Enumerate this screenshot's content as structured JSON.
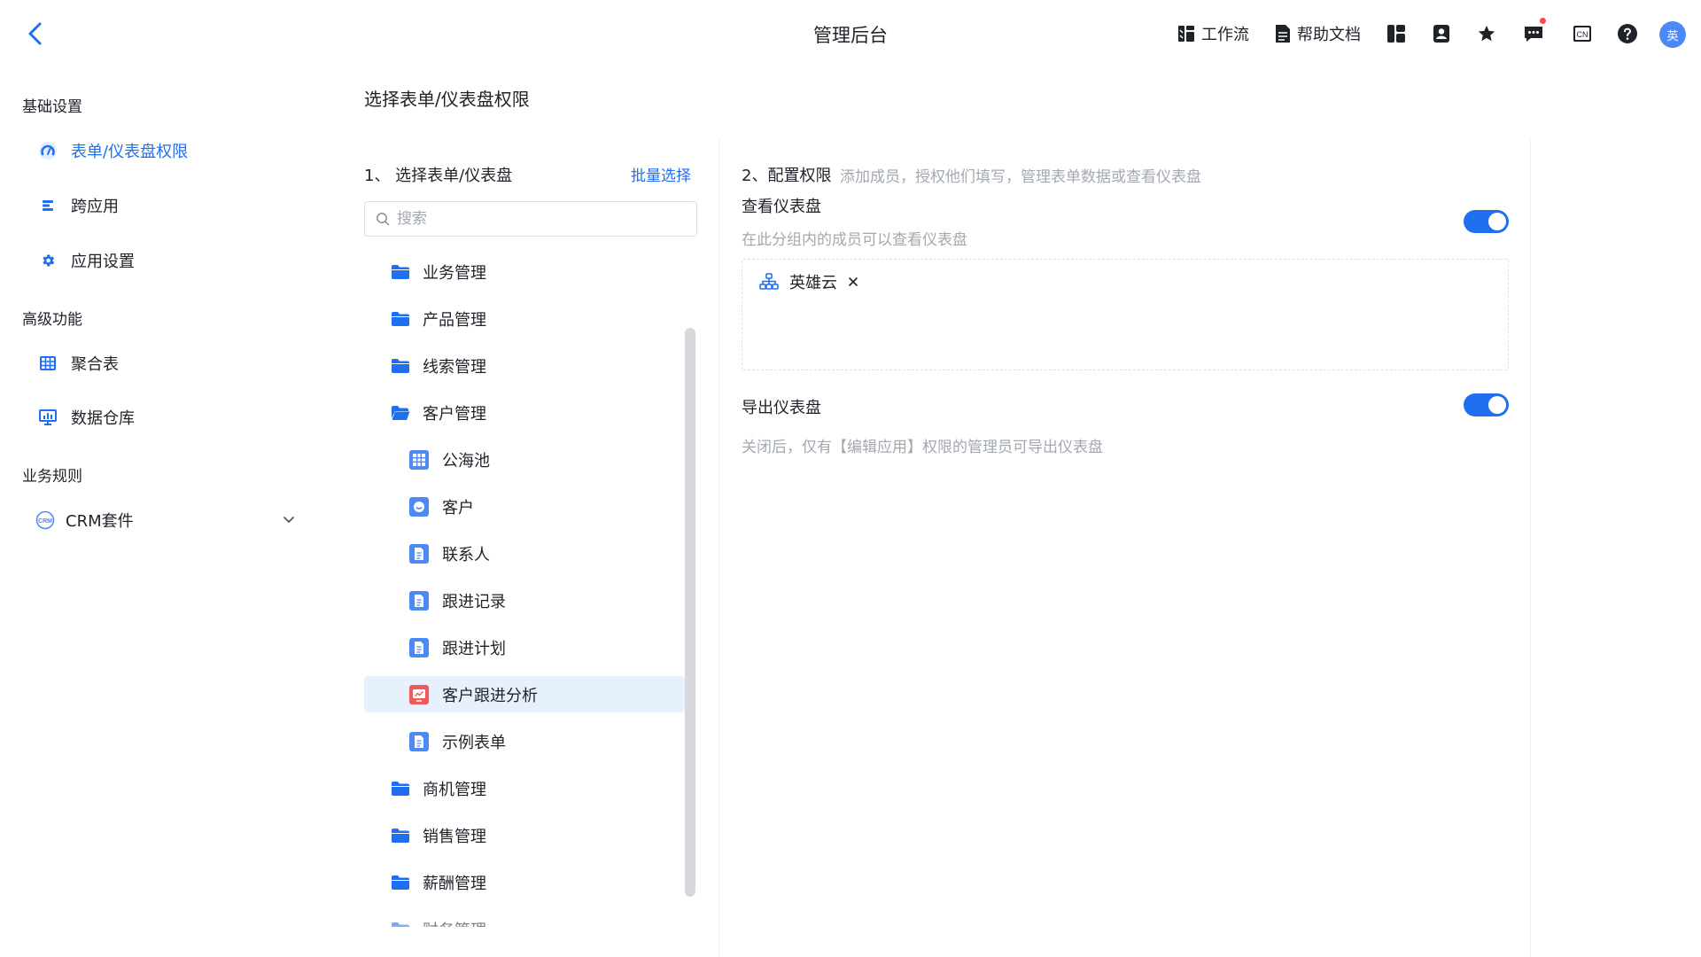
{
  "header": {
    "title": "管理后台",
    "workflow_label": "工作流",
    "help_label": "帮助文档",
    "avatar_text": "英",
    "lang_label": "CN"
  },
  "sidebar": {
    "sections": [
      {
        "title": "基础设置",
        "items": [
          {
            "label": "表单/仪表盘权限",
            "icon": "dashboard-gauge-icon",
            "active": true
          },
          {
            "label": "跨应用",
            "icon": "cross-app-icon"
          },
          {
            "label": "应用设置",
            "icon": "gear-icon"
          }
        ]
      },
      {
        "title": "高级功能",
        "items": [
          {
            "label": "聚合表",
            "icon": "table-grid-icon"
          },
          {
            "label": "数据仓库",
            "icon": "data-warehouse-icon"
          }
        ]
      },
      {
        "title": "业务规则",
        "items": [
          {
            "label": "CRM套件",
            "icon": "crm-icon",
            "expandable": true
          }
        ]
      }
    ]
  },
  "main": {
    "title": "选择表单/仪表盘权限",
    "step1_label": "1、 选择表单/仪表盘",
    "batch_select_label": "批量选择",
    "search_placeholder": "搜索",
    "tree": [
      {
        "label": "业务管理",
        "type": "folder"
      },
      {
        "label": "产品管理",
        "type": "folder"
      },
      {
        "label": "线索管理",
        "type": "folder"
      },
      {
        "label": "客户管理",
        "type": "folder-open"
      },
      {
        "label": "公海池",
        "type": "table"
      },
      {
        "label": "客户",
        "type": "customer"
      },
      {
        "label": "联系人",
        "type": "form"
      },
      {
        "label": "跟进记录",
        "type": "form"
      },
      {
        "label": "跟进计划",
        "type": "form"
      },
      {
        "label": "客户跟进分析",
        "type": "dashboard",
        "selected": true
      },
      {
        "label": "示例表单",
        "type": "form"
      },
      {
        "label": "商机管理",
        "type": "folder"
      },
      {
        "label": "销售管理",
        "type": "folder"
      },
      {
        "label": "薪酬管理",
        "type": "folder"
      },
      {
        "label": "财务管理",
        "type": "folder"
      }
    ]
  },
  "permissions": {
    "step2_label": "2、配置权限",
    "step2_desc": "添加成员，授权他们填写，管理表单数据或查看仪表盘",
    "view": {
      "title": "查看仪表盘",
      "desc": "在此分组内的成员可以查看仪表盘",
      "enabled": true,
      "members": [
        {
          "name": "英雄云",
          "icon": "org-structure-icon"
        }
      ]
    },
    "export": {
      "title": "导出仪表盘",
      "desc": "关闭后，仅有【编辑应用】权限的管理员可导出仪表盘",
      "enabled": true
    }
  },
  "colors": {
    "accent": "#1f6ff0",
    "selected_bg": "#e6f1fd",
    "muted_text": "#a3a8b1",
    "folder_icon": "#1f6ff0",
    "form_icon": "#4d89f5",
    "dashboard_icon": "#f05a5a",
    "notify_dot": "#f54a45"
  }
}
